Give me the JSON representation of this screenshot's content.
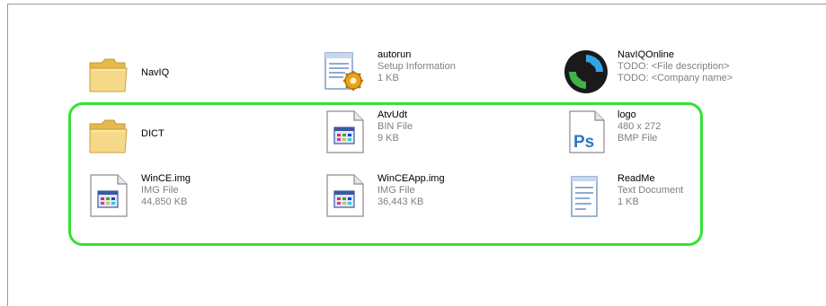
{
  "colors": {
    "highlight": "#33e233",
    "folder": "#f2d176",
    "metadata_text": "#808080"
  },
  "files": [
    {
      "name": "NavIQ",
      "details": [],
      "icon": "folder-icon"
    },
    {
      "name": "autorun",
      "details": [
        "Setup Information",
        "1 KB"
      ],
      "icon": "setup-info-icon"
    },
    {
      "name": "NavIQOnline",
      "details": [
        "TODO: <File description>",
        "TODO: <Company name>"
      ],
      "icon": "app-sync-icon"
    },
    {
      "name": "DICT",
      "details": [],
      "icon": "folder-icon"
    },
    {
      "name": "AtvUdt",
      "details": [
        "BIN File",
        "9 KB"
      ],
      "icon": "generic-file-icon"
    },
    {
      "name": "logo",
      "details": [
        "480 x 272",
        "BMP File"
      ],
      "icon": "photoshop-icon"
    },
    {
      "name": "WinCE.img",
      "details": [
        "IMG File",
        "44,850 KB"
      ],
      "icon": "generic-file-icon"
    },
    {
      "name": "WinCEApp.img",
      "details": [
        "IMG File",
        "36,443 KB"
      ],
      "icon": "generic-file-icon"
    },
    {
      "name": "ReadMe",
      "details": [
        "Text Document",
        "1 KB"
      ],
      "icon": "text-document-icon"
    }
  ]
}
